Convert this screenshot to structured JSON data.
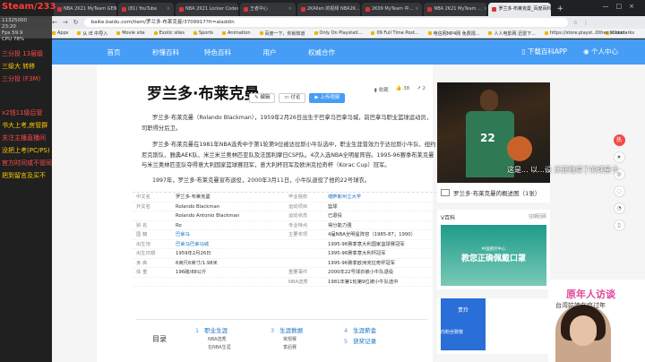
{
  "browser": {
    "tabs": [
      {
        "label": "NBA 2K21 MyTeam GENIUS"
      },
      {
        "label": "(81) YouTube"
      },
      {
        "label": "NBA 2K21 Locker Codes - NB"
      },
      {
        "label": "王者中心"
      },
      {
        "label": "2KAllen 的视频 NBA2K..."
      },
      {
        "label": "2K09 MyTeam 中..."
      },
      {
        "label": "NBA 2K21 MyTeam ..."
      },
      {
        "label": "罗兰多·布莱克曼_百度百科",
        "active": true
      }
    ],
    "new_tab": "+",
    "url": "baike.baidu.com/item/罗兰多·布莱克曼/3709917?fr=aladdin",
    "bookmarks": [
      "Apps",
      "从 IE 中导入",
      "Movie site",
      "Exotic sites",
      "Sports",
      "Animation",
      "百度一下，你就知道",
      "Only On Playstati...",
      "09 Full Time Post...",
      "电信网MP4网 免费视...",
      "人人电影网 迅雷下...",
      "https://store.playst...",
      "iCloud"
    ],
    "other_bookmarks": "Other bookmarks"
  },
  "stream_overlay": {
    "title": "Steam/233",
    "stats": [
      "11325000",
      "23:20",
      "Fps 59.9",
      "CPU 78%"
    ],
    "lines": [
      {
        "text": "三分投 13层级",
        "color": "#ff4a4a"
      },
      {
        "text": "三级大 转移",
        "color": "#ffcc00"
      },
      {
        "text": "三分投 (F3M)",
        "color": "#ff4a4a"
      },
      {
        "text": "x2钱11级后管",
        "color": "#ff4a4a"
      },
      {
        "text": "书大上考,房管群",
        "color": "#ffcc00"
      },
      {
        "text": "关注主播直播间",
        "color": "#ff4a4a"
      },
      {
        "text": "没把上考(PC/PS)",
        "color": "#ffcc00"
      },
      {
        "text": "官方时间或不管同",
        "color": "#ff4a4a"
      },
      {
        "text": "把到留言及买不",
        "color": "#ffcc00"
      }
    ],
    "danmu": "这是... 以...设 沃亚晓得了的球星卡",
    "ad_title": "原年人访谈",
    "ad_sub": "台湾姑娘在京过年"
  },
  "baike_nav": {
    "items": [
      "首页",
      "秒懂百科",
      "特色百科",
      "用户",
      "权威合作"
    ],
    "app": "下载百科APP",
    "center": "个人中心"
  },
  "entry": {
    "title": "罗兰多·布莱克曼",
    "btn_edit": "编辑",
    "btn_discuss": "讨论",
    "btn_upload": "上传视频",
    "collect": "收藏",
    "likes": "38",
    "shares": "2",
    "para1": "罗兰多·布莱克曼（Rolando Blackman），1959年2月26日出生于巴拿马巴拿马城，前巴拿马职业篮球运动员，司职得分后卫。",
    "para2": "罗兰多·布莱克曼在1981年NBA选秀中于第1轮第9位被达拉斯小牛队选中，职业生涯曾效力于达拉斯小牛队、纽约尼克斯队、雅典AEK队、米兰米兰奥林匹亚队及法国利摩日CSP队。4次入选NBA全明星阵容。1995-96赛季布莱克曼与米兰奥林匹亚队夺得意大利国家篮球赛冠军，意大利杯冠军及欧洲克拉奇杯（Korac Cup）冠军。",
    "para3": "1997年，罗兰多·布莱克曼宣布退役，2000年3月11日，小牛队退役了他的22号球衣。",
    "info": [
      {
        "k1": "中文名",
        "v1": "罗兰多·布莱克曼",
        "k2": "毕业院校",
        "v2": "堪萨斯州立大学",
        "link2": true
      },
      {
        "k1": "外文名",
        "v1": "Rolando Blackman",
        "k2": "运动项目",
        "v2": "篮球"
      },
      {
        "k1": "",
        "v1": "Rolando Antonio Blackman",
        "k2": "运动状态",
        "v2": "已退役"
      },
      {
        "k1": "别    名",
        "v1": "Ro",
        "k2": "专业特点",
        "v2": "得分能力强"
      },
      {
        "k1": "国    籍",
        "v1": "巴拿马",
        "k2": "主要奖项",
        "v2": "4届NBA全明星阵容（1985-87；1990）",
        "link1": true
      },
      {
        "k1": "出生地",
        "v1": "巴拿马巴拿马城",
        "k2": "",
        "v2": "1995-96赛季意大利国家篮球赛冠军",
        "link1": true
      },
      {
        "k1": "出生日期",
        "v1": "1959年2月26日",
        "k2": "",
        "v2": "1995-96赛季意大利杯冠军"
      },
      {
        "k1": "身    高",
        "v1": "6英尺6英寸/1.98米",
        "k2": "",
        "v2": "1995-96赛季欧洲克拉奇杯冠军"
      },
      {
        "k1": "体    重",
        "v1": "196磅/88公斤",
        "k2": "重要事件",
        "v2": "2000年22号球衣被小牛队退役"
      },
      {
        "k1": "",
        "v1": "",
        "k2": "NBA选秀",
        "v2": "1981年第1轮第9位被小牛队选中"
      }
    ],
    "toc_label": "目录",
    "toc": [
      {
        "num": "1",
        "label": "职业生涯",
        "subs": [
          "NBA选秀",
          "在NBA生涯"
        ]
      },
      {
        "num": "3",
        "label": "生涯数据",
        "subs": [
          "常规赛",
          "季后赛"
        ]
      },
      {
        "num": "4",
        "label": "生涯薪金",
        "subs": []
      },
      {
        "num": "5",
        "label": "获奖记录",
        "subs": []
      }
    ]
  },
  "sidebar": {
    "photo_number": "22",
    "photo_caption": "罗兰多·布莱克曼的概述图（1张）",
    "vcard_title": "V百科",
    "vcard_more": "往期回顾",
    "ad_text": "教您正确佩戴口罩",
    "ad_small": "中国疾控中心",
    "ad2_text": "贵玲",
    "ad2_sub": "向粉丝致敬"
  }
}
